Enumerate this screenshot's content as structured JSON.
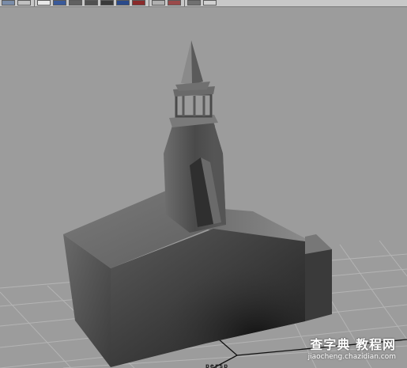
{
  "toolbar": {
    "icons": [
      {
        "name": "select-icon",
        "color": "#7a8ca8"
      },
      {
        "name": "render-settings-icon",
        "color": "#c0c0c0"
      },
      {
        "name": "wireframe-cube-icon",
        "color": "#e8e8e8"
      },
      {
        "name": "shaded-sphere-icon",
        "color": "#3a5a9a"
      },
      {
        "name": "smooth-shade-icon",
        "color": "#606060"
      },
      {
        "name": "texture-icon",
        "color": "#505050"
      },
      {
        "name": "lighting-icon",
        "color": "#3a3a3a"
      },
      {
        "name": "display-icon",
        "color": "#2a4a8a"
      },
      {
        "name": "shadow-icon",
        "color": "#8a2a2a"
      },
      {
        "name": "camera-icon",
        "color": "#b0b0b0"
      },
      {
        "name": "grid-icon",
        "color": "#9a4a4a"
      },
      {
        "name": "isolate-icon",
        "color": "#707070"
      },
      {
        "name": "xray-icon",
        "color": "#d0d0d0"
      }
    ]
  },
  "viewport": {
    "camera_label": "persp",
    "background": "#9c9c9c",
    "grid_color": "#b4b4b4",
    "axis_color": "#101010"
  },
  "watermark": {
    "main": "查字典 教程网",
    "sub": "jiaocheng.chazidian.com"
  }
}
